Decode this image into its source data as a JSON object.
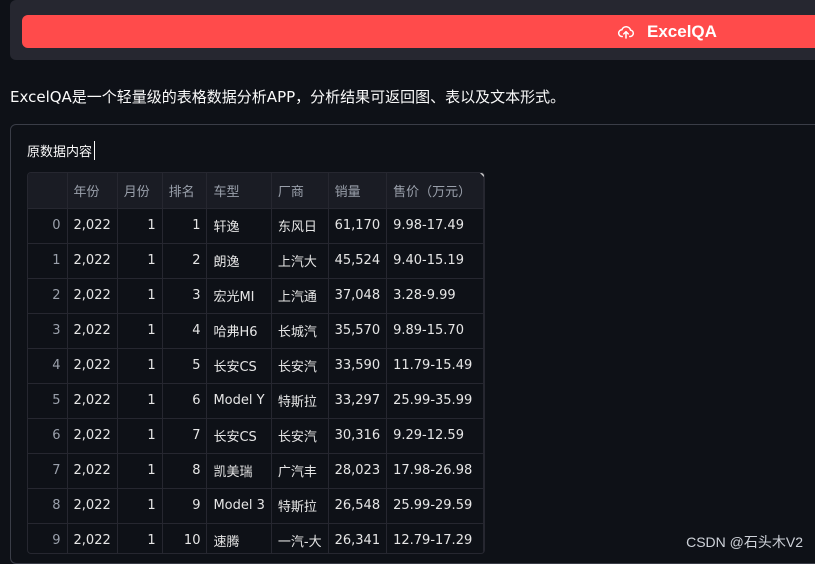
{
  "app_button": {
    "label": "ExcelQA",
    "icon": "cloud-upload-icon"
  },
  "description": "ExcelQA是一个轻量级的表格数据分析APP，分析结果可返回图、表以及文本形式。",
  "panel": {
    "title": "原数据内容"
  },
  "table": {
    "columns": [
      "",
      "年份",
      "月份",
      "排名",
      "车型",
      "厂商",
      "销量",
      "售价（万元）"
    ],
    "rows": [
      [
        "0",
        "2,022",
        "1",
        "1",
        "轩逸",
        "东风日",
        "61,170",
        "9.98-17.49"
      ],
      [
        "1",
        "2,022",
        "1",
        "2",
        "朗逸",
        "上汽大",
        "45,524",
        "9.40-15.19"
      ],
      [
        "2",
        "2,022",
        "1",
        "3",
        "宏光MI",
        "上汽通",
        "37,048",
        "3.28-9.99"
      ],
      [
        "3",
        "2,022",
        "1",
        "4",
        "哈弗H6",
        "长城汽",
        "35,570",
        "9.89-15.70"
      ],
      [
        "4",
        "2,022",
        "1",
        "5",
        "长安CS",
        "长安汽",
        "33,590",
        "11.79-15.49"
      ],
      [
        "5",
        "2,022",
        "1",
        "6",
        "Model Y",
        "特斯拉",
        "33,297",
        "25.99-35.99"
      ],
      [
        "6",
        "2,022",
        "1",
        "7",
        "长安CS",
        "长安汽",
        "30,316",
        "9.29-12.59"
      ],
      [
        "7",
        "2,022",
        "1",
        "8",
        "凯美瑞",
        "广汽丰",
        "28,023",
        "17.98-26.98"
      ],
      [
        "8",
        "2,022",
        "1",
        "9",
        "Model 3",
        "特斯拉",
        "26,548",
        "25.99-29.59"
      ],
      [
        "9",
        "2,022",
        "1",
        "10",
        "速腾",
        "一汽-大",
        "26,341",
        "12.79-17.29"
      ]
    ]
  },
  "watermark": "CSDN @石头木V2"
}
